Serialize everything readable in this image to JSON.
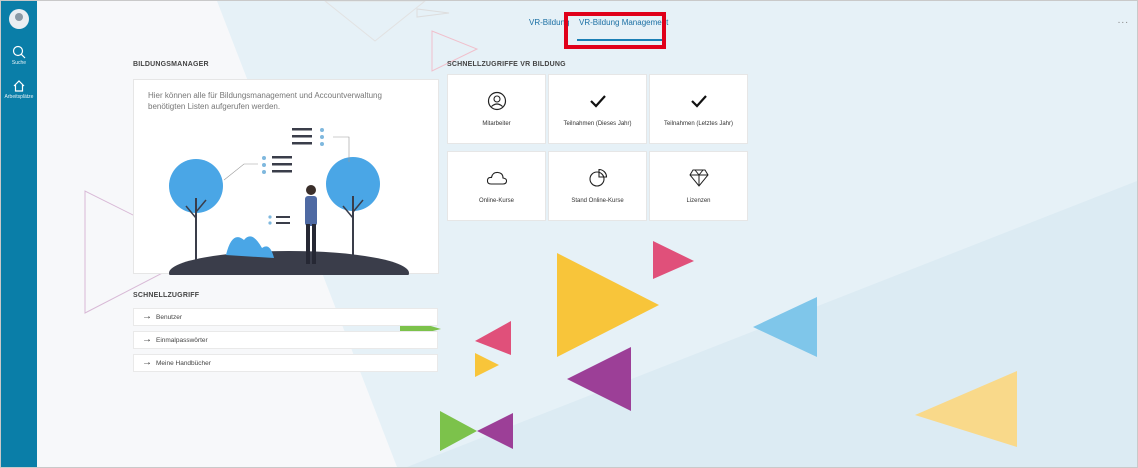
{
  "sidebar": {
    "search_label": "Suche",
    "home_label": "Arbeitsplätze"
  },
  "tabs": [
    {
      "label": "VR-Bildung",
      "active": false
    },
    {
      "label": "VR-Bildung Management",
      "active": true
    }
  ],
  "more_menu": "...",
  "bildungsmanager": {
    "title": "BILDUNGSMANAGER",
    "text": "Hier können alle für Bildungsmanagement und Accountverwaltung benötigten Listen aufgerufen werden."
  },
  "schnellzugriffe": {
    "title": "SCHNELLZUGRIFFE VR BILDUNG",
    "tiles": [
      {
        "label": "Mitarbeiter",
        "icon": "user-circle-icon"
      },
      {
        "label": "Teilnahmen (Dieses Jahr)",
        "icon": "checkmark-icon"
      },
      {
        "label": "Teilnahmen (Letztes Jahr)",
        "icon": "checkmark-icon"
      },
      {
        "label": "Online-Kurse",
        "icon": "cloud-icon"
      },
      {
        "label": "Stand Online-Kurse",
        "icon": "pie-chart-icon"
      },
      {
        "label": "Lizenzen",
        "icon": "diamond-icon"
      }
    ]
  },
  "schnellzugriff": {
    "title": "SCHNELLZUGRIFF",
    "links": [
      {
        "label": "Benutzer"
      },
      {
        "label": "Einmalpasswörter"
      },
      {
        "label": "Meine Handbücher"
      }
    ]
  },
  "colors": {
    "sidebar": "#0a7ea8",
    "tab": "#1a6fa3",
    "highlight": "#e0001a",
    "tree": "#4aa6e6",
    "yellow": "#f8c53a",
    "pink": "#e0507a",
    "purple": "#9c3f97",
    "green": "#7cc24b",
    "lightblue": "#7fc6ea"
  }
}
